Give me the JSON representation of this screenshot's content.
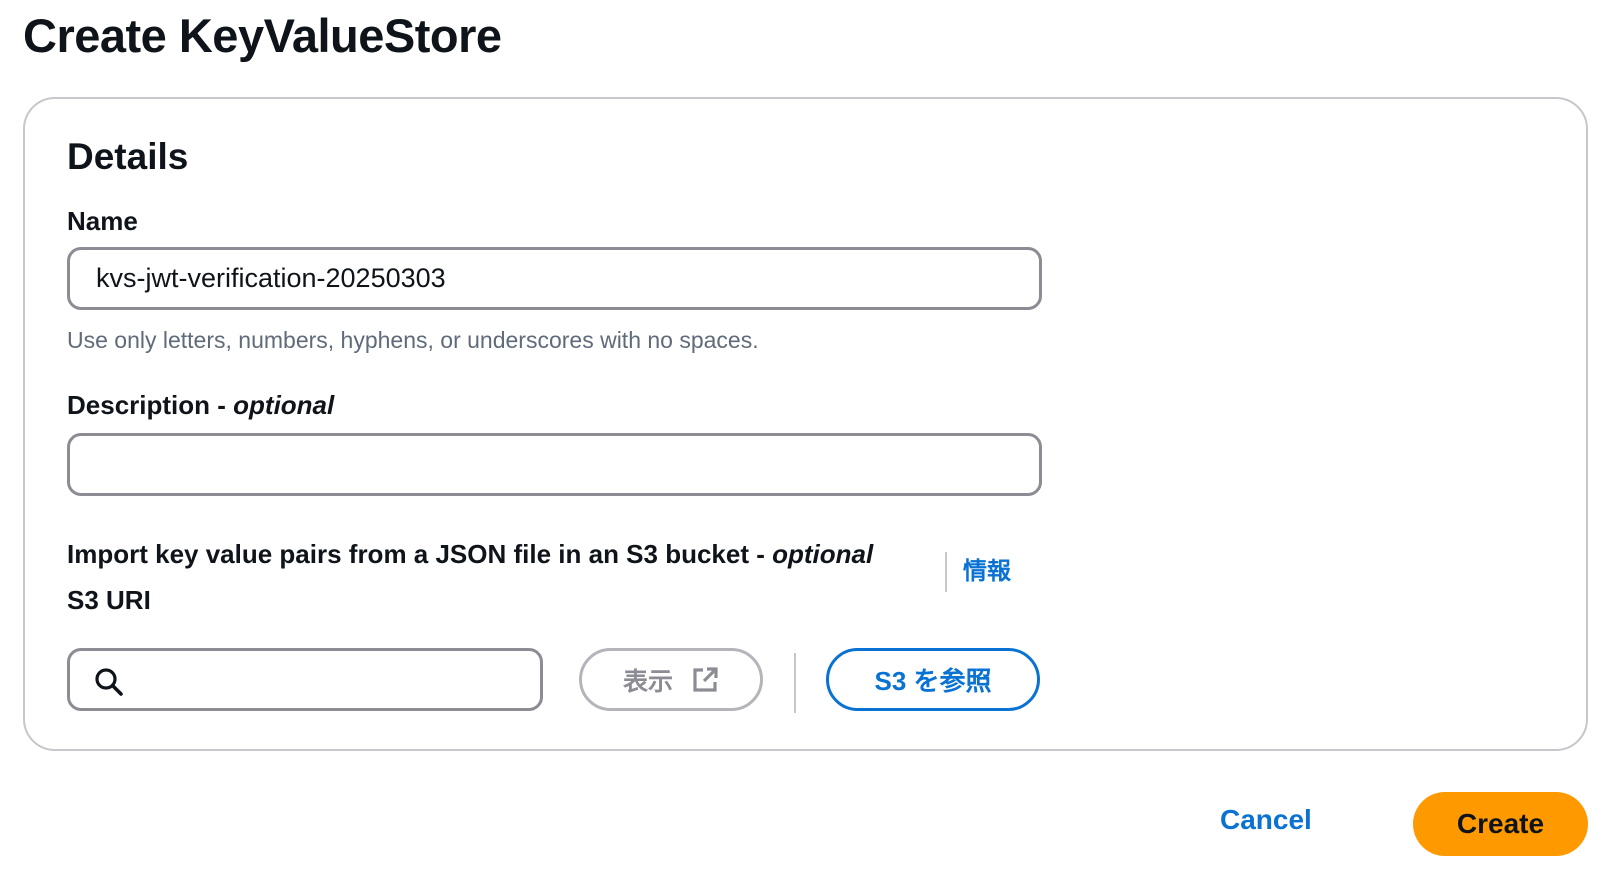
{
  "page": {
    "title": "Create KeyValueStore"
  },
  "details": {
    "section_title": "Details",
    "name": {
      "label": "Name",
      "value": "kvs-jwt-verification-20250303",
      "hint": "Use only letters, numbers, hyphens, or underscores with no spaces."
    },
    "description": {
      "label": "Description - ",
      "optional": "optional",
      "value": ""
    },
    "import": {
      "label": "Import key value pairs from a JSON file in an S3 bucket - ",
      "optional": "optional",
      "info_link": "情報",
      "s3_uri_label": "S3 URI",
      "s3_uri_value": "",
      "view_button": "表示",
      "browse_button": "S3 を参照"
    }
  },
  "actions": {
    "cancel": "Cancel",
    "create": "Create"
  },
  "colors": {
    "primary_link": "#0972d3",
    "create_button": "#ff9900",
    "border": "#8c8c94"
  },
  "icons": {
    "search": "search-icon",
    "external_link": "external-link-icon"
  }
}
